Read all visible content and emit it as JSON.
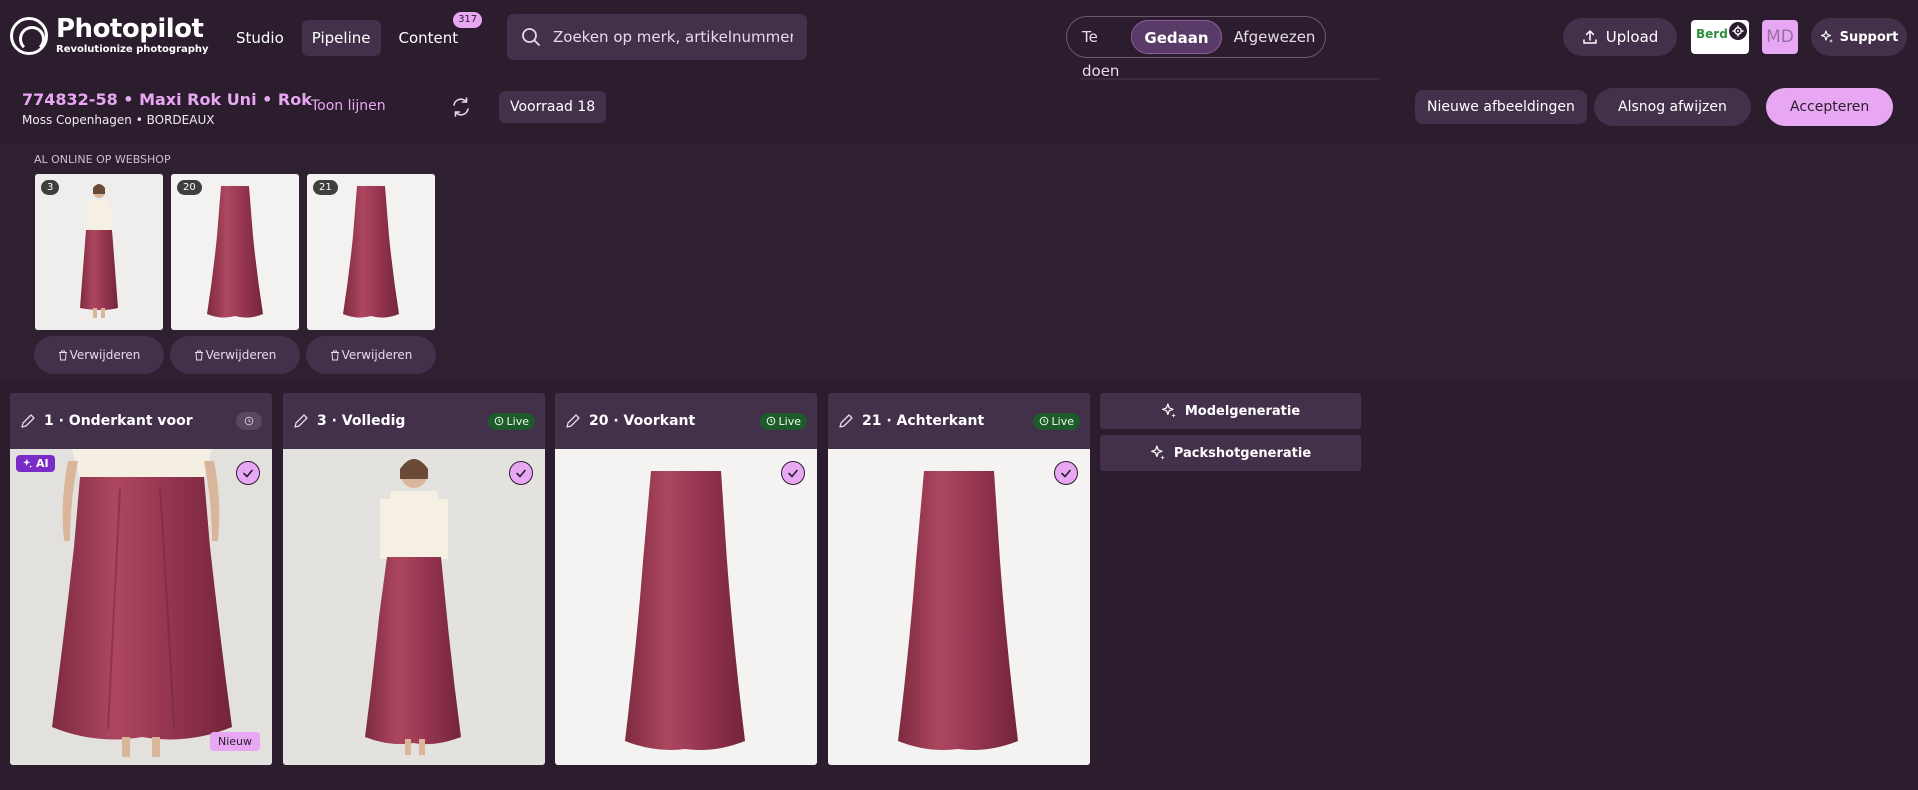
{
  "app": {
    "name": "Photopilot",
    "tagline": "Revolutionize photography"
  },
  "nav": [
    {
      "label": "Studio"
    },
    {
      "label": "Pipeline",
      "active": true
    },
    {
      "label": "Content",
      "badge": "317"
    }
  ],
  "search": {
    "placeholder": "Zoeken op merk, artikelnummer.."
  },
  "status_tabs": [
    {
      "label": "Te doen"
    },
    {
      "label": "Gedaan",
      "active": true
    },
    {
      "label": "Afgewezen"
    }
  ],
  "top_actions": {
    "upload": "Upload",
    "support": "Support",
    "avatar": "MD",
    "brand_text": "Berd"
  },
  "product": {
    "title": "774832-58 • Maxi Rok Uni • Rok",
    "subtitle": "Moss Copenhagen • BORDEAUX",
    "toggle_lines": "Toon lijnen",
    "stock": "Voorraad 18",
    "actions": {
      "new_images": "Nieuwe afbeeldingen",
      "reject": "Alsnog afwijzen",
      "accept": "Accepteren"
    }
  },
  "online": {
    "label": "AL ONLINE OP WEBSHOP",
    "delete_label": "Verwijderen",
    "thumbs": [
      {
        "badge": "3"
      },
      {
        "badge": "20"
      },
      {
        "badge": "21"
      }
    ]
  },
  "cards": [
    {
      "title": "1 · Onderkant voor",
      "status": "history",
      "ai": "AI",
      "new": "Nieuw"
    },
    {
      "title": "3 · Volledig",
      "status": "Live"
    },
    {
      "title": "20 · Voorkant",
      "status": "Live"
    },
    {
      "title": "21 · Achterkant",
      "status": "Live"
    }
  ],
  "generation": {
    "model": "Modelgeneratie",
    "packshot": "Packshotgeneratie"
  },
  "colors": {
    "background": "#2b1d2d",
    "panel": "#43304a",
    "accent": "#e8a7f3",
    "live": "#1f5a2b",
    "skirt": "#a03c55"
  }
}
